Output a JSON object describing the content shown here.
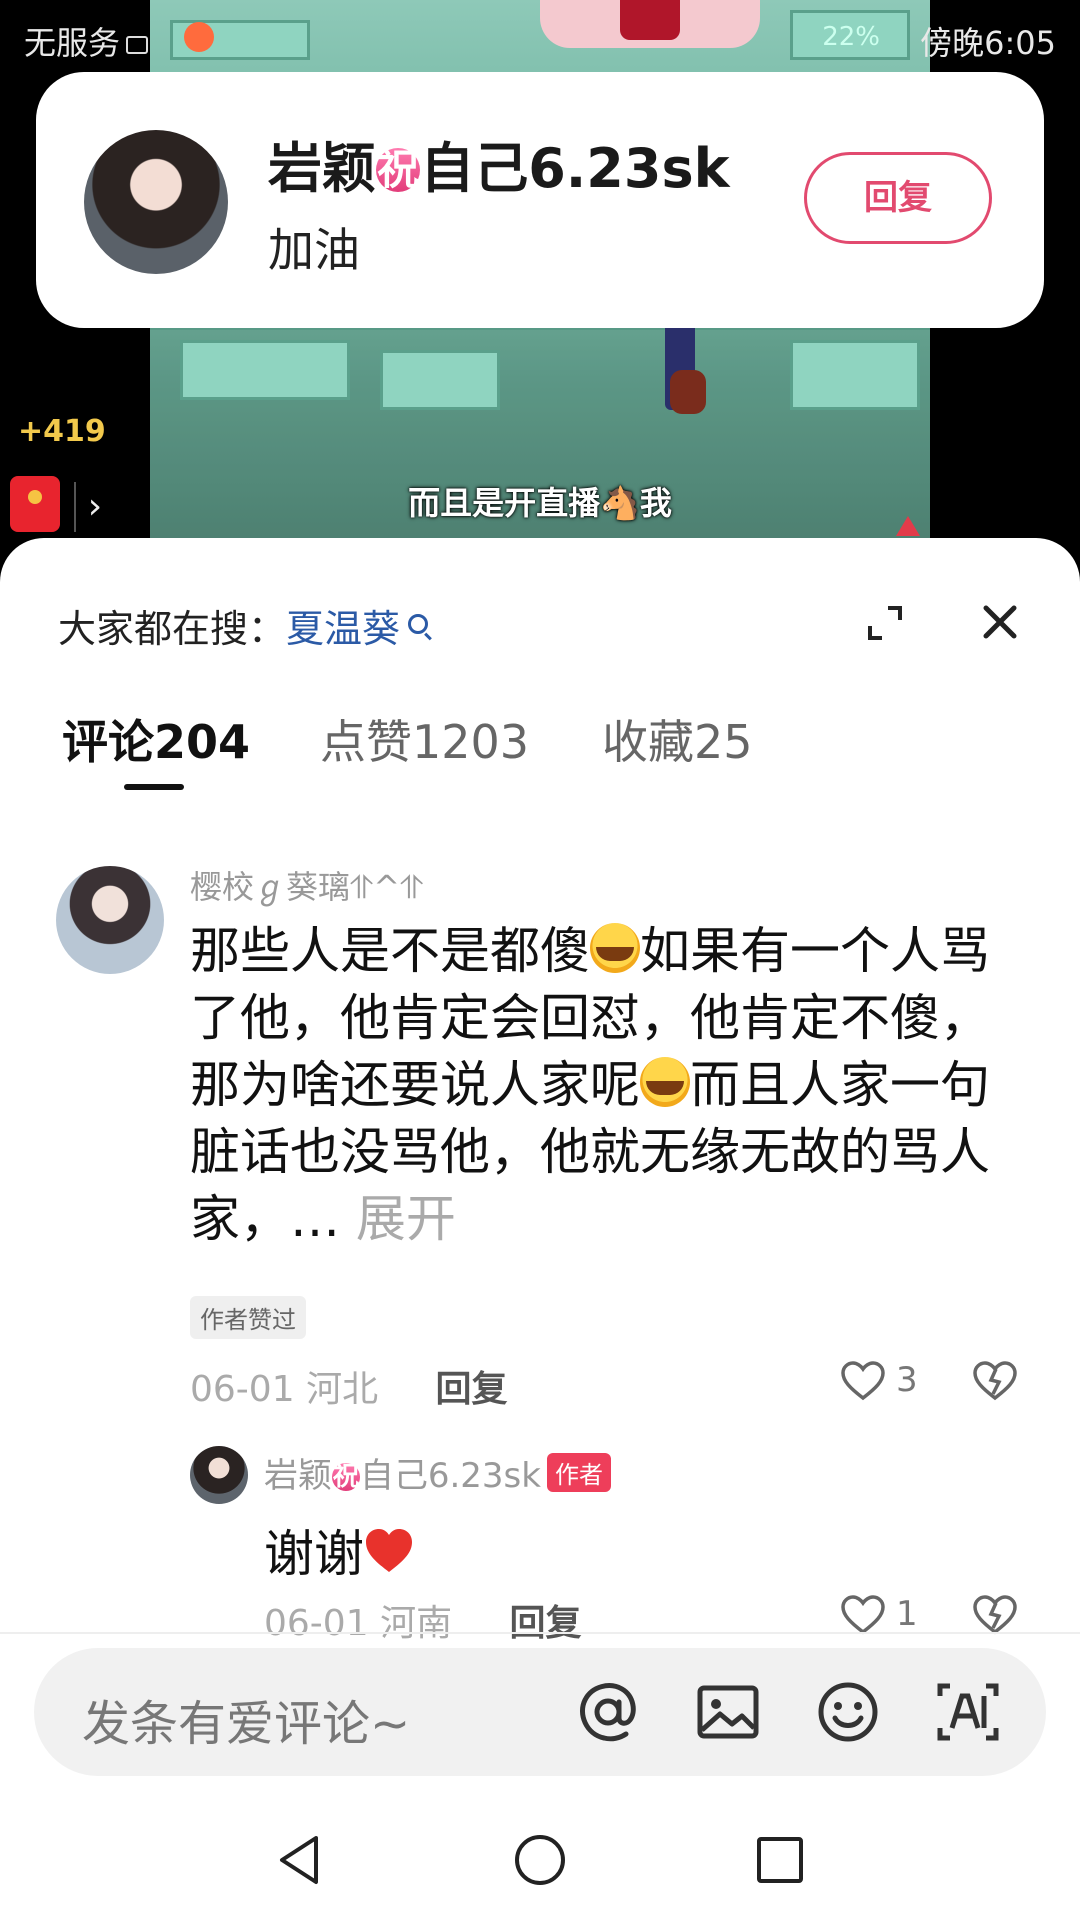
{
  "status_bar": {
    "carrier": "无服务",
    "battery": "22%",
    "time": "傍晚6:05"
  },
  "video": {
    "subtitle": "而且是开直播🐴我"
  },
  "notification": {
    "sender_name": "岩颖",
    "sender_badge": "祝",
    "sender_suffix": "自己6.23sk",
    "message": "加油",
    "reply_label": "回复"
  },
  "side": {
    "like_delta": "+419",
    "arrow": "›"
  },
  "search": {
    "prefix": "大家都在搜：",
    "keyword": "夏温葵"
  },
  "tabs": [
    {
      "label": "评论",
      "count": "204"
    },
    {
      "label": "点赞",
      "count": "1203"
    },
    {
      "label": "收藏",
      "count": "25"
    }
  ],
  "comment": {
    "username": "樱校ℊ葵璃⥣^⥣",
    "text_1": "那些人是不是都傻",
    "text_2": "如果有一个人骂了他，他肯定会回怼，他肯定不傻，那为啥还要说人家呢",
    "text_3": "而且人家一句脏话也没骂他，他就无缘无故的骂人家，…",
    "expand": "展开",
    "author_liked": "作者赞过",
    "date": "06-01",
    "location": "河北",
    "reply_label": "回复",
    "likes": "3"
  },
  "reply": {
    "username": "岩颖",
    "badge": "祝",
    "username_suffix": "自己6.23sk",
    "author_tag": "作者",
    "text": "谢谢",
    "date": "06-01",
    "location": "河南",
    "reply_label": "回复",
    "likes": "1"
  },
  "input": {
    "placeholder": "发条有爱评论~"
  },
  "colors": {
    "accent": "#e24a6f",
    "author_tag": "#ee3e5a",
    "search_keyword": "#2b5aa6"
  }
}
